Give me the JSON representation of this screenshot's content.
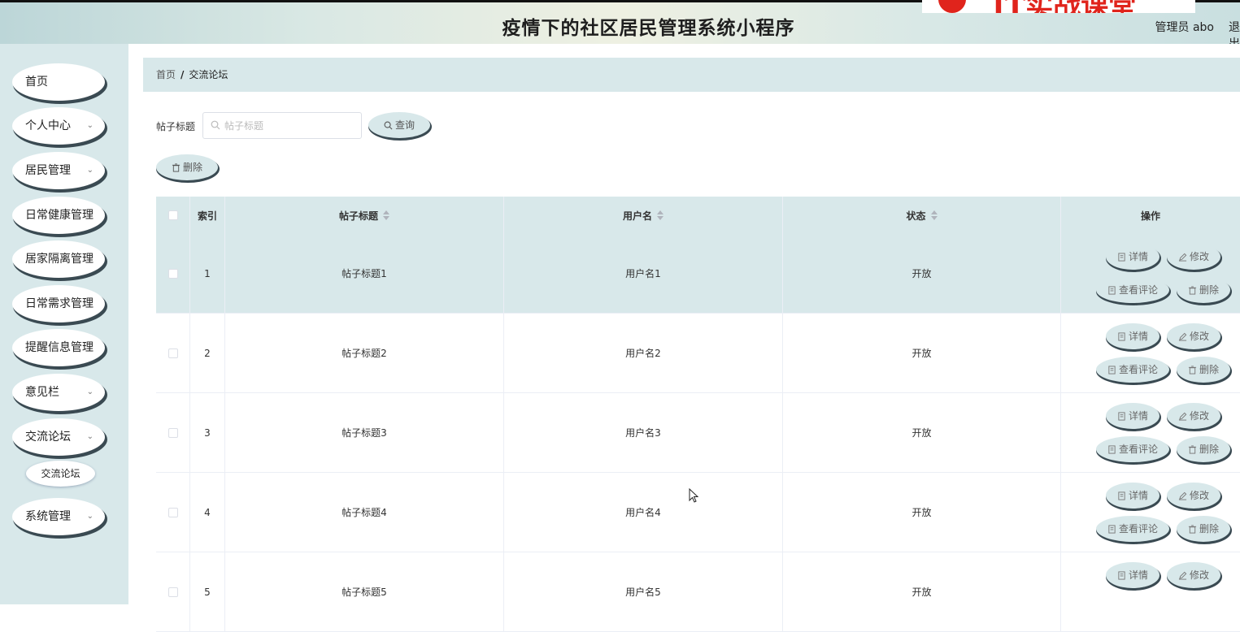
{
  "header": {
    "title": "疫情下的社区居民管理系统小程序",
    "user": "管理员 abo",
    "logout": "退出",
    "logo_text": "IT实战课堂"
  },
  "sidebar": {
    "items": [
      {
        "label": "首页",
        "has_chevron": false
      },
      {
        "label": "个人中心",
        "has_chevron": true
      },
      {
        "label": "居民管理",
        "has_chevron": true
      },
      {
        "label": "日常健康管理",
        "has_chevron": true
      },
      {
        "label": "居家隔离管理",
        "has_chevron": true
      },
      {
        "label": "日常需求管理",
        "has_chevron": true
      },
      {
        "label": "提醒信息管理",
        "has_chevron": true
      },
      {
        "label": "意见栏",
        "has_chevron": true
      },
      {
        "label": "交流论坛",
        "has_chevron": true
      },
      {
        "label": "系统管理",
        "has_chevron": true
      }
    ],
    "submenu": {
      "label": "交流论坛"
    }
  },
  "breadcrumb": {
    "home": "首页",
    "separator": "/",
    "current": "交流论坛"
  },
  "search": {
    "label": "帖子标题",
    "placeholder": "帖子标题",
    "button": "查询"
  },
  "toolbar": {
    "delete": "删除"
  },
  "table": {
    "columns": {
      "index": "索引",
      "title": "帖子标题",
      "username": "用户名",
      "status": "状态",
      "ops": "操作"
    },
    "rows": [
      {
        "index": "1",
        "title": "帖子标题1",
        "username": "用户名1",
        "status": "开放"
      },
      {
        "index": "2",
        "title": "帖子标题2",
        "username": "用户名2",
        "status": "开放"
      },
      {
        "index": "3",
        "title": "帖子标题3",
        "username": "用户名3",
        "status": "开放"
      },
      {
        "index": "4",
        "title": "帖子标题4",
        "username": "用户名4",
        "status": "开放"
      },
      {
        "index": "5",
        "title": "帖子标题5",
        "username": "用户名5",
        "status": "开放"
      }
    ],
    "actions": {
      "detail": "详情",
      "edit": "修改",
      "comments": "查看评论",
      "delete": "删除"
    }
  },
  "colors": {
    "accent": "#d8e8ea",
    "shadow": "#3a4a52",
    "logo_red": "#e0241c"
  }
}
